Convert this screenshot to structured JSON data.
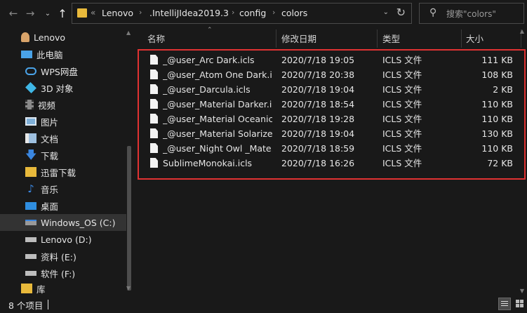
{
  "toolbar": {
    "back_icon": "arrow-left",
    "forward_icon": "arrow-right",
    "recent_icon": "chevron-down",
    "up_icon": "arrow-up",
    "overflow": "«",
    "breadcrumb": [
      "Lenovo",
      ".IntelliJIdea2019.3",
      "config",
      "colors"
    ],
    "separator": "›",
    "dropdown": "⌄",
    "refresh": "↻",
    "search_placeholder": "搜索\"colors\""
  },
  "sidebar": {
    "items": [
      {
        "label": "Lenovo",
        "icon": "user-folder-icon",
        "color": "#d9a46a"
      },
      {
        "label": "此电脑",
        "icon": "computer-icon",
        "color": "#4aa3e8"
      },
      {
        "label": "WPS网盘",
        "icon": "cloud-icon",
        "color": "#4aa3e8"
      },
      {
        "label": "3D 对象",
        "icon": "cube-icon",
        "color": "#3fb7e6"
      },
      {
        "label": "视频",
        "icon": "video-icon",
        "color": "#8a8a8a"
      },
      {
        "label": "图片",
        "icon": "picture-icon",
        "color": "#7fb0d8"
      },
      {
        "label": "文档",
        "icon": "document-icon",
        "color": "#9ec0e0"
      },
      {
        "label": "下载",
        "icon": "download-icon",
        "color": "#3a86e0"
      },
      {
        "label": "迅雷下载",
        "icon": "thunder-folder-icon",
        "color": "#e8b93b"
      },
      {
        "label": "音乐",
        "icon": "music-icon",
        "color": "#3a86e0"
      },
      {
        "label": "桌面",
        "icon": "desktop-icon",
        "color": "#2f8ee0"
      },
      {
        "label": "Windows_OS (C:)",
        "icon": "system-drive-icon",
        "color": "#9a9a9a",
        "selected": true
      },
      {
        "label": "Lenovo (D:)",
        "icon": "drive-icon",
        "color": "#bdbdbd"
      },
      {
        "label": "资料 (E:)",
        "icon": "drive-icon",
        "color": "#bdbdbd"
      },
      {
        "label": "软件 (F:)",
        "icon": "drive-icon",
        "color": "#bdbdbd"
      },
      {
        "label": "库",
        "icon": "library-icon",
        "color": "#e8b93b"
      }
    ]
  },
  "columns": {
    "name": "名称",
    "date": "修改日期",
    "type": "类型",
    "size": "大小"
  },
  "files": [
    {
      "name": "_@user_Arc Dark.icls",
      "date": "2020/7/18 19:05",
      "type": "ICLS 文件",
      "size": "111 KB"
    },
    {
      "name": "_@user_Atom One Dark.i...",
      "date": "2020/7/18 20:38",
      "type": "ICLS 文件",
      "size": "108 KB"
    },
    {
      "name": "_@user_Darcula.icls",
      "date": "2020/7/18 19:04",
      "type": "ICLS 文件",
      "size": "2 KB"
    },
    {
      "name": "_@user_Material Darker.i...",
      "date": "2020/7/18 18:54",
      "type": "ICLS 文件",
      "size": "110 KB"
    },
    {
      "name": "_@user_Material Oceanic...",
      "date": "2020/7/18 19:28",
      "type": "ICLS 文件",
      "size": "110 KB"
    },
    {
      "name": "_@user_Material Solarize...",
      "date": "2020/7/18 19:04",
      "type": "ICLS 文件",
      "size": "130 KB"
    },
    {
      "name": "_@user_Night Owl _Mate...",
      "date": "2020/7/18 18:59",
      "type": "ICLS 文件",
      "size": "110 KB"
    },
    {
      "name": "SublimeMonokai.icls",
      "date": "2020/7/18 16:26",
      "type": "ICLS 文件",
      "size": "72 KB"
    }
  ],
  "status": {
    "item_count": "8 个项目"
  },
  "colors": {
    "highlight_border": "#e03232",
    "background": "#191919",
    "selected_bg": "#333333"
  }
}
